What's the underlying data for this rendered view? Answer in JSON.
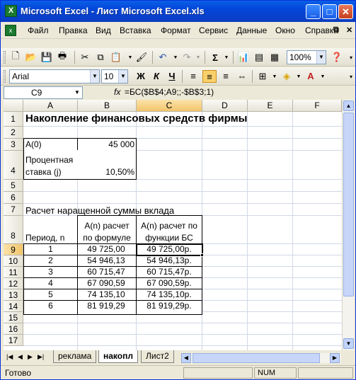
{
  "window": {
    "title": "Microsoft Excel - Лист Microsoft Excel.xls",
    "app_icon": "X",
    "doc_icon": "x"
  },
  "menu": [
    "Файл",
    "Правка",
    "Вид",
    "Вставка",
    "Формат",
    "Сервис",
    "Данные",
    "Окно",
    "Справка"
  ],
  "toolbar": {
    "zoom": "100%",
    "sum_symbol": "Σ"
  },
  "format": {
    "font": "Arial",
    "size": "10",
    "bold": "Ж",
    "italic": "К",
    "underline": "Ч"
  },
  "formula_bar": {
    "cell_ref": "C9",
    "fx": "fx",
    "formula": "=БС($B$4;A9;;-$B$3;1)"
  },
  "columns": [
    "A",
    "B",
    "C",
    "D",
    "E",
    "F"
  ],
  "rows": [
    "1",
    "2",
    "3",
    "4",
    "5",
    "6",
    "7",
    "8",
    "9",
    "10",
    "11",
    "12",
    "13",
    "14",
    "15",
    "16",
    "17"
  ],
  "cells": {
    "a1": "Накопление финансовых средств фирмы",
    "a3": "А(0)",
    "b3": "45 000",
    "a4_line1": "Процентная",
    "a4_line2": "ставка (j)",
    "b4": "10,50%",
    "a7": "Расчет наращенной суммы вклада",
    "a8": "Период, n",
    "b8_line1": "А(n) расчет",
    "b8_line2": "по формуле",
    "c8_line1": "А(n) расчет по",
    "c8_line2": "функции БС"
  },
  "table": [
    {
      "n": "1",
      "formula": "49 725,00",
      "func": "49 725,00р."
    },
    {
      "n": "2",
      "formula": "54 946,13",
      "func": "54 946,13р."
    },
    {
      "n": "3",
      "formula": "60 715,47",
      "func": "60 715,47р."
    },
    {
      "n": "4",
      "formula": "67 090,59",
      "func": "67 090,59р."
    },
    {
      "n": "5",
      "formula": "74 135,10",
      "func": "74 135,10р."
    },
    {
      "n": "6",
      "formula": "81 919,29",
      "func": "81 919,29р."
    }
  ],
  "sheets": [
    "реклама",
    "накопл",
    "Лист2"
  ],
  "status": {
    "text": "Готово",
    "num": "NUM"
  }
}
